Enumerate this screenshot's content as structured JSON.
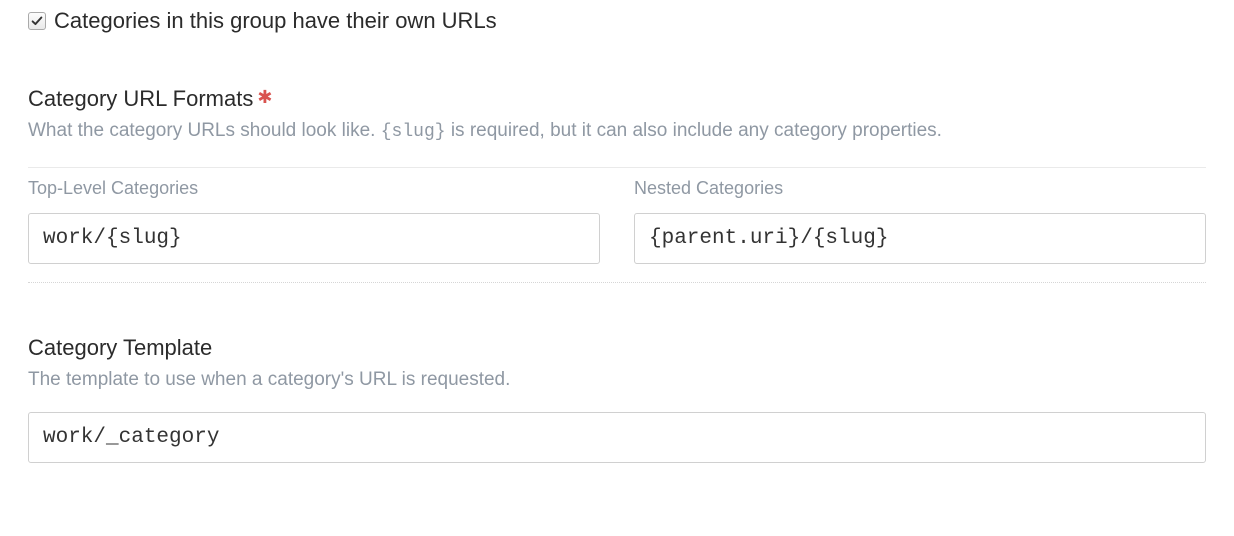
{
  "checkbox": {
    "label": "Categories in this group have their own URLs",
    "checked": true
  },
  "urlFormats": {
    "heading": "Category URL Formats",
    "required": true,
    "description_pre": "What the category URLs should look like. ",
    "description_code": "{slug}",
    "description_post": " is required, but it can also include any category properties.",
    "topLevel": {
      "header": "Top-Level Categories",
      "value": "work/{slug}"
    },
    "nested": {
      "header": "Nested Categories",
      "value": "{parent.uri}/{slug}"
    }
  },
  "template": {
    "heading": "Category Template",
    "description": "The template to use when a category's URL is requested.",
    "value": "work/_category"
  }
}
